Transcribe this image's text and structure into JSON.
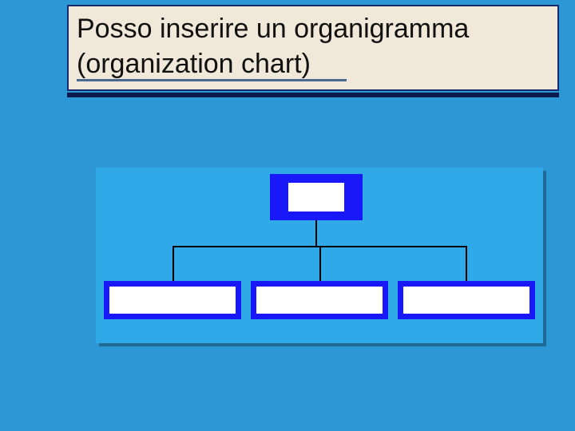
{
  "title": "Posso inserire un organigramma (organization chart)",
  "chart_data": {
    "type": "org-chart",
    "root": {
      "label": ""
    },
    "children": [
      {
        "label": ""
      },
      {
        "label": ""
      },
      {
        "label": ""
      }
    ],
    "colors": {
      "slide_bg": "#2d97d5",
      "title_bg": "#f0e8d8",
      "chart_bg": "#30a9e8",
      "node_border": "#1818f8",
      "node_fill": "#ffffff",
      "connector": "#000000"
    }
  }
}
